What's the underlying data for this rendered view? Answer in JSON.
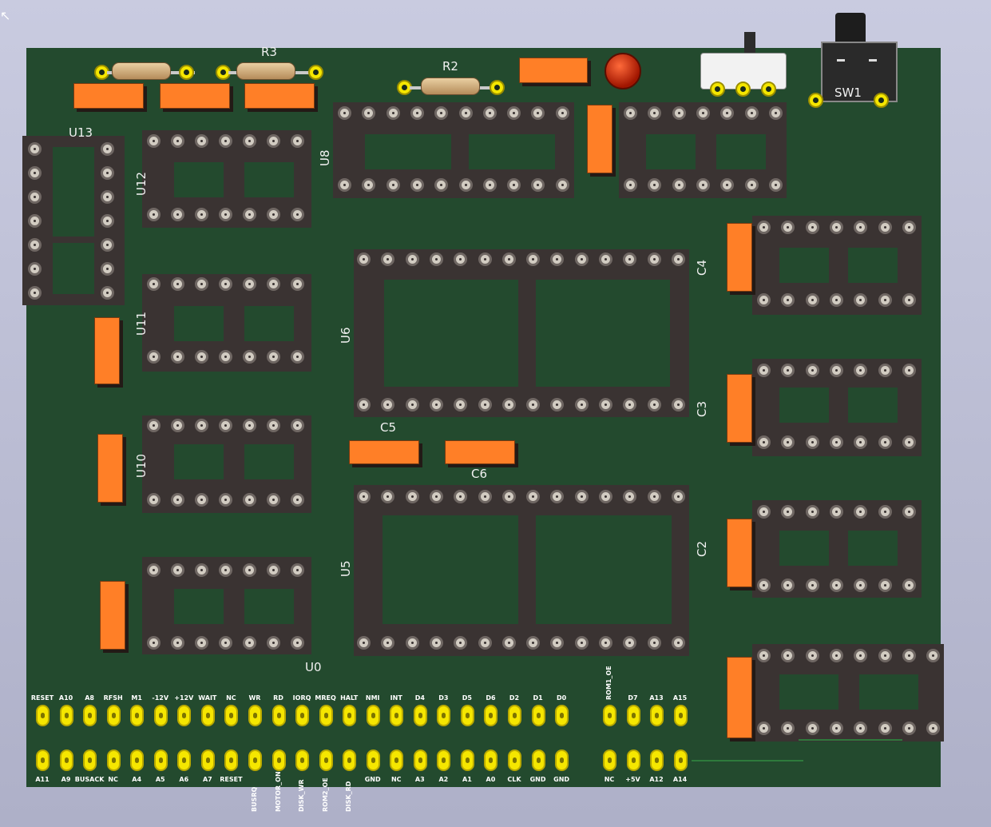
{
  "colors": {
    "board": "#234a2e",
    "socket": "#3a3332",
    "capacitor": "#ff7f27",
    "header_pad": "#f5e600",
    "silkscreen": "#f1f1f1"
  },
  "components": {
    "r3": "R3",
    "r2": "R2",
    "sw1": "SW1",
    "u13": "U13",
    "u12": "U12",
    "u11": "U11",
    "u10": "U10",
    "u0": "U0",
    "u8": "U8",
    "u6": "U6",
    "u5": "U5",
    "c5": "C5",
    "c6": "C6",
    "c4": "C4",
    "c3": "C3",
    "c2": "C2"
  },
  "header": {
    "top_row": [
      "RESET",
      "A10",
      "A8",
      "RFSH",
      "M1",
      "-12V",
      "+12V",
      "WAIT",
      "NC",
      "WR",
      "RD",
      "IORQ",
      "MREQ",
      "HALT",
      "NMI",
      "INT",
      "D4",
      "D3",
      "D5",
      "D6",
      "D2",
      "D1",
      "D0"
    ],
    "bottom_row": [
      "A11",
      "A9",
      "BUSACK",
      "NC",
      "A4",
      "A5",
      "A6",
      "A7",
      "RESET",
      "BUSRQ",
      "MOTOR_ON",
      "DISK_WR",
      "ROM2_OE",
      "DISK_RD",
      "GND",
      "NC",
      "A3",
      "A2",
      "A1",
      "A0",
      "CLK",
      "GND",
      "GND"
    ],
    "right_top": [
      "ROM1_OE",
      "D7",
      "A13",
      "A15"
    ],
    "right_bottom": [
      "NC",
      "+5V",
      "A12",
      "A14"
    ]
  }
}
